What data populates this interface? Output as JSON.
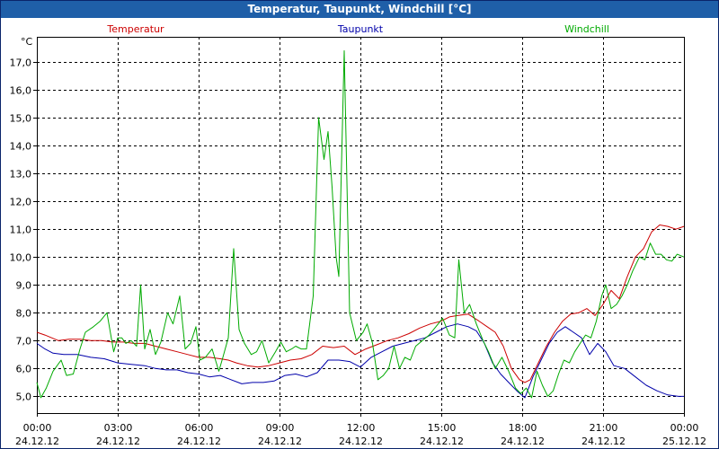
{
  "window": {
    "title": "Temperatur, Taupunkt, Windchill [°C]"
  },
  "chart_data": {
    "type": "line",
    "title": "Temperatur, Taupunkt, Windchill [°C]",
    "ylabel": "°C",
    "xlabel": "",
    "ylim": [
      4.4,
      17.9
    ],
    "xlim": [
      0,
      24
    ],
    "grid": true,
    "legend": "top, inline",
    "y_ticks": [
      "5,0",
      "6,0",
      "7,0",
      "8,0",
      "9,0",
      "10,0",
      "11,0",
      "12,0",
      "13,0",
      "14,0",
      "15,0",
      "16,0",
      "17,0"
    ],
    "y_tick_values": [
      5,
      6,
      7,
      8,
      9,
      10,
      11,
      12,
      13,
      14,
      15,
      16,
      17
    ],
    "x_ticks": [
      {
        "x": 0,
        "time": "00:00",
        "date": "24.12.12"
      },
      {
        "x": 3,
        "time": "03:00",
        "date": "24.12.12"
      },
      {
        "x": 6,
        "time": "06:00",
        "date": "24.12.12"
      },
      {
        "x": 9,
        "time": "09:00",
        "date": "24.12.12"
      },
      {
        "x": 12,
        "time": "12:00",
        "date": "24.12.12"
      },
      {
        "x": 15,
        "time": "15:00",
        "date": "24.12.12"
      },
      {
        "x": 18,
        "time": "18:00",
        "date": "24.12.12"
      },
      {
        "x": 21,
        "time": "21:00",
        "date": "24.12.12"
      },
      {
        "x": 24,
        "time": "00:00",
        "date": "25.12.12"
      }
    ],
    "series": [
      {
        "name": "Temperatur",
        "color": "#cc0000",
        "points": [
          [
            0,
            7.3
          ],
          [
            0.3,
            7.2
          ],
          [
            0.8,
            7.0
          ],
          [
            1.2,
            7.05
          ],
          [
            1.6,
            7.05
          ],
          [
            2.0,
            7.0
          ],
          [
            2.4,
            7.0
          ],
          [
            2.8,
            6.95
          ],
          [
            3.2,
            6.95
          ],
          [
            3.6,
            6.9
          ],
          [
            4.0,
            6.9
          ],
          [
            4.4,
            6.8
          ],
          [
            4.8,
            6.7
          ],
          [
            5.2,
            6.6
          ],
          [
            5.6,
            6.5
          ],
          [
            6.0,
            6.4
          ],
          [
            6.4,
            6.4
          ],
          [
            6.8,
            6.35
          ],
          [
            7.1,
            6.3
          ],
          [
            7.4,
            6.2
          ],
          [
            7.8,
            6.1
          ],
          [
            8.2,
            6.05
          ],
          [
            8.6,
            6.1
          ],
          [
            9.0,
            6.2
          ],
          [
            9.4,
            6.3
          ],
          [
            9.8,
            6.35
          ],
          [
            10.2,
            6.5
          ],
          [
            10.6,
            6.8
          ],
          [
            11.0,
            6.75
          ],
          [
            11.4,
            6.8
          ],
          [
            11.8,
            6.5
          ],
          [
            12.2,
            6.7
          ],
          [
            12.6,
            6.85
          ],
          [
            13.0,
            7.0
          ],
          [
            13.4,
            7.1
          ],
          [
            13.8,
            7.25
          ],
          [
            14.2,
            7.45
          ],
          [
            14.6,
            7.6
          ],
          [
            15.0,
            7.7
          ],
          [
            15.3,
            7.85
          ],
          [
            15.6,
            7.9
          ],
          [
            16.0,
            7.95
          ],
          [
            16.4,
            7.7
          ],
          [
            16.7,
            7.5
          ],
          [
            17.0,
            7.3
          ],
          [
            17.3,
            6.8
          ],
          [
            17.6,
            6.0
          ],
          [
            17.9,
            5.6
          ],
          [
            18.1,
            5.5
          ],
          [
            18.3,
            5.6
          ],
          [
            18.6,
            6.2
          ],
          [
            18.9,
            6.8
          ],
          [
            19.2,
            7.3
          ],
          [
            19.5,
            7.7
          ],
          [
            19.8,
            7.95
          ],
          [
            20.1,
            8.0
          ],
          [
            20.4,
            8.15
          ],
          [
            20.7,
            7.9
          ],
          [
            21.0,
            8.3
          ],
          [
            21.3,
            8.8
          ],
          [
            21.6,
            8.5
          ],
          [
            21.9,
            9.3
          ],
          [
            22.2,
            10.0
          ],
          [
            22.5,
            10.3
          ],
          [
            22.8,
            10.9
          ],
          [
            23.1,
            11.15
          ],
          [
            23.4,
            11.1
          ],
          [
            23.7,
            11.0
          ],
          [
            24.0,
            11.1
          ]
        ]
      },
      {
        "name": "Taupunkt",
        "color": "#0000aa",
        "points": [
          [
            0,
            6.9
          ],
          [
            0.3,
            6.7
          ],
          [
            0.6,
            6.55
          ],
          [
            1.0,
            6.5
          ],
          [
            1.5,
            6.5
          ],
          [
            2.0,
            6.4
          ],
          [
            2.5,
            6.35
          ],
          [
            3.0,
            6.2
          ],
          [
            3.5,
            6.15
          ],
          [
            4.0,
            6.1
          ],
          [
            4.4,
            6.0
          ],
          [
            4.8,
            5.95
          ],
          [
            5.2,
            5.95
          ],
          [
            5.6,
            5.85
          ],
          [
            6.0,
            5.8
          ],
          [
            6.4,
            5.7
          ],
          [
            6.8,
            5.75
          ],
          [
            7.2,
            5.6
          ],
          [
            7.6,
            5.45
          ],
          [
            8.0,
            5.5
          ],
          [
            8.4,
            5.5
          ],
          [
            8.8,
            5.55
          ],
          [
            9.2,
            5.75
          ],
          [
            9.6,
            5.8
          ],
          [
            10.0,
            5.7
          ],
          [
            10.4,
            5.85
          ],
          [
            10.8,
            6.3
          ],
          [
            11.2,
            6.3
          ],
          [
            11.6,
            6.25
          ],
          [
            12.0,
            6.05
          ],
          [
            12.4,
            6.4
          ],
          [
            12.8,
            6.6
          ],
          [
            13.2,
            6.8
          ],
          [
            13.6,
            6.9
          ],
          [
            14.0,
            7.0
          ],
          [
            14.4,
            7.1
          ],
          [
            14.8,
            7.3
          ],
          [
            15.2,
            7.5
          ],
          [
            15.6,
            7.6
          ],
          [
            16.0,
            7.5
          ],
          [
            16.3,
            7.35
          ],
          [
            16.6,
            6.9
          ],
          [
            16.9,
            6.2
          ],
          [
            17.2,
            5.8
          ],
          [
            17.5,
            5.5
          ],
          [
            17.8,
            5.2
          ],
          [
            18.1,
            4.95
          ],
          [
            18.4,
            5.7
          ],
          [
            18.7,
            6.3
          ],
          [
            19.0,
            6.9
          ],
          [
            19.3,
            7.3
          ],
          [
            19.6,
            7.5
          ],
          [
            19.9,
            7.3
          ],
          [
            20.2,
            7.1
          ],
          [
            20.5,
            6.5
          ],
          [
            20.8,
            6.9
          ],
          [
            21.1,
            6.6
          ],
          [
            21.4,
            6.1
          ],
          [
            21.8,
            6.0
          ],
          [
            22.2,
            5.7
          ],
          [
            22.6,
            5.4
          ],
          [
            23.0,
            5.2
          ],
          [
            23.4,
            5.05
          ],
          [
            23.8,
            5.0
          ],
          [
            24.0,
            5.0
          ]
        ]
      },
      {
        "name": "Windchill",
        "color": "#00aa00",
        "points": [
          [
            0,
            5.5
          ],
          [
            0.15,
            4.95
          ],
          [
            0.35,
            5.3
          ],
          [
            0.6,
            5.9
          ],
          [
            0.9,
            6.3
          ],
          [
            1.1,
            5.75
          ],
          [
            1.35,
            5.8
          ],
          [
            1.6,
            6.7
          ],
          [
            1.8,
            7.3
          ],
          [
            2.1,
            7.5
          ],
          [
            2.35,
            7.7
          ],
          [
            2.6,
            8.0
          ],
          [
            2.85,
            6.6
          ],
          [
            3.0,
            7.1
          ],
          [
            3.15,
            7.1
          ],
          [
            3.3,
            6.9
          ],
          [
            3.5,
            7.0
          ],
          [
            3.7,
            6.8
          ],
          [
            3.85,
            9.0
          ],
          [
            4.0,
            6.7
          ],
          [
            4.2,
            7.4
          ],
          [
            4.4,
            6.5
          ],
          [
            4.6,
            6.95
          ],
          [
            4.85,
            8.0
          ],
          [
            5.05,
            7.6
          ],
          [
            5.3,
            8.6
          ],
          [
            5.5,
            6.7
          ],
          [
            5.7,
            6.9
          ],
          [
            5.9,
            7.5
          ],
          [
            6.05,
            6.3
          ],
          [
            6.25,
            6.4
          ],
          [
            6.5,
            6.7
          ],
          [
            6.75,
            5.9
          ],
          [
            6.9,
            6.4
          ],
          [
            7.1,
            7.1
          ],
          [
            7.3,
            10.3
          ],
          [
            7.5,
            7.4
          ],
          [
            7.7,
            6.9
          ],
          [
            7.95,
            6.5
          ],
          [
            8.15,
            6.6
          ],
          [
            8.35,
            7.0
          ],
          [
            8.6,
            6.2
          ],
          [
            8.85,
            6.6
          ],
          [
            9.05,
            6.95
          ],
          [
            9.25,
            6.6
          ],
          [
            9.45,
            6.7
          ],
          [
            9.6,
            6.8
          ],
          [
            9.8,
            6.7
          ],
          [
            10.0,
            6.7
          ],
          [
            10.25,
            8.6
          ],
          [
            10.45,
            15.0
          ],
          [
            10.65,
            13.5
          ],
          [
            10.8,
            14.5
          ],
          [
            10.95,
            12.5
          ],
          [
            11.1,
            10.0
          ],
          [
            11.2,
            9.3
          ],
          [
            11.4,
            17.4
          ],
          [
            11.6,
            8.0
          ],
          [
            11.85,
            7.0
          ],
          [
            12.1,
            7.3
          ],
          [
            12.25,
            7.6
          ],
          [
            12.45,
            6.9
          ],
          [
            12.65,
            5.6
          ],
          [
            12.85,
            5.75
          ],
          [
            13.05,
            6.0
          ],
          [
            13.25,
            6.8
          ],
          [
            13.45,
            6.0
          ],
          [
            13.65,
            6.4
          ],
          [
            13.85,
            6.3
          ],
          [
            14.05,
            6.8
          ],
          [
            14.3,
            7.0
          ],
          [
            14.55,
            7.2
          ],
          [
            14.8,
            7.5
          ],
          [
            15.05,
            7.8
          ],
          [
            15.3,
            7.2
          ],
          [
            15.5,
            7.1
          ],
          [
            15.65,
            9.9
          ],
          [
            15.85,
            8.0
          ],
          [
            16.05,
            8.3
          ],
          [
            16.3,
            7.6
          ],
          [
            16.55,
            7.0
          ],
          [
            16.75,
            6.6
          ],
          [
            17.0,
            6.0
          ],
          [
            17.25,
            6.4
          ],
          [
            17.5,
            5.9
          ],
          [
            17.75,
            5.3
          ],
          [
            17.95,
            5.1
          ],
          [
            18.15,
            5.3
          ],
          [
            18.35,
            4.95
          ],
          [
            18.55,
            5.9
          ],
          [
            18.75,
            5.4
          ],
          [
            18.95,
            5.0
          ],
          [
            19.15,
            5.2
          ],
          [
            19.35,
            5.8
          ],
          [
            19.55,
            6.3
          ],
          [
            19.75,
            6.2
          ],
          [
            19.95,
            6.6
          ],
          [
            20.15,
            6.9
          ],
          [
            20.35,
            7.2
          ],
          [
            20.55,
            7.1
          ],
          [
            20.75,
            7.7
          ],
          [
            20.95,
            8.6
          ],
          [
            21.1,
            9.0
          ],
          [
            21.3,
            8.15
          ],
          [
            21.5,
            8.3
          ],
          [
            21.7,
            8.6
          ],
          [
            21.9,
            9.0
          ],
          [
            22.1,
            9.5
          ],
          [
            22.35,
            10.0
          ],
          [
            22.55,
            9.9
          ],
          [
            22.75,
            10.5
          ],
          [
            22.95,
            10.1
          ],
          [
            23.15,
            10.1
          ],
          [
            23.35,
            9.9
          ],
          [
            23.55,
            9.85
          ],
          [
            23.75,
            10.1
          ],
          [
            24.0,
            10.0
          ]
        ]
      }
    ]
  }
}
